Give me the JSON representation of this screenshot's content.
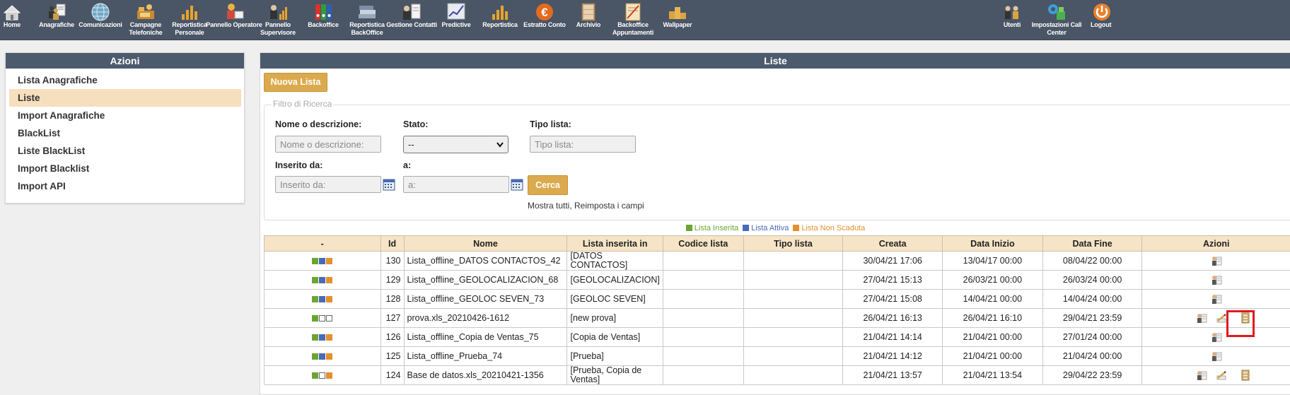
{
  "nav": {
    "items": [
      {
        "label": "Home",
        "icon": "home-icon"
      },
      {
        "label": "Anagrafiche",
        "icon": "people-document-icon"
      },
      {
        "label": "Comunicazioni",
        "icon": "globe-icon"
      },
      {
        "label": "Campagne Telefoniche",
        "icon": "campaign-icon"
      },
      {
        "label": "Reportistica Personale",
        "icon": "bar-chart-icon"
      },
      {
        "label": "Pannello Operatore",
        "icon": "operator-icon"
      },
      {
        "label": "Pannello Supervisore",
        "icon": "supervisor-icon"
      },
      {
        "label": "Backoffice",
        "icon": "binders-icon"
      },
      {
        "label": "Reportistica BackOffice",
        "icon": "books-icon"
      },
      {
        "label": "Gestione Contatti",
        "icon": "contacts-icon"
      },
      {
        "label": "Predictive",
        "icon": "trend-chart-icon"
      },
      {
        "label": "Reportistica",
        "icon": "bar-chart-icon"
      },
      {
        "label": "Estratto Conto",
        "icon": "euro-coin-icon"
      },
      {
        "label": "Archivio",
        "icon": "cabinet-icon"
      },
      {
        "label": "Backoffice Appuntamenti",
        "icon": "appointment-icon"
      },
      {
        "label": "Wallpaper",
        "icon": "podium-icon"
      }
    ],
    "right_items": [
      {
        "label": "Utenti",
        "icon": "users-icon"
      },
      {
        "label": "Impostazioni Call Center",
        "icon": "settings-gears-icon"
      },
      {
        "label": "Logout",
        "icon": "power-icon"
      }
    ]
  },
  "sidebar": {
    "title": "Azioni",
    "items": [
      {
        "label": "Lista Anagrafiche",
        "active": false
      },
      {
        "label": "Liste",
        "active": true
      },
      {
        "label": "Import Anagrafiche",
        "active": false
      },
      {
        "label": "BlackList",
        "active": false
      },
      {
        "label": "Liste BlackList",
        "active": false
      },
      {
        "label": "Import Blacklist",
        "active": false
      },
      {
        "label": "Import API",
        "active": false
      }
    ]
  },
  "main": {
    "title": "Liste",
    "new_button": "Nuova Lista",
    "filter": {
      "legend": "Filtro di Ricerca",
      "name_label": "Nome o descrizione:",
      "name_placeholder": "Nome o descrizione:",
      "state_label": "Stato:",
      "state_value": "--",
      "type_label": "Tipo lista:",
      "type_placeholder": "Tipo lista:",
      "from_label": "Inserito da:",
      "from_placeholder": "Inserito da:",
      "to_label": "a:",
      "to_placeholder": "a:",
      "search_button": "Cerca",
      "reset_text": "Mostra tutti, Reimposta i campi"
    },
    "legend": [
      {
        "label": "Lista Inserita",
        "color": "#6aa532"
      },
      {
        "label": "Lista Attiva",
        "color": "#4a6ab7"
      },
      {
        "label": "Lista Non Scaduta",
        "color": "#e3902d"
      }
    ],
    "table": {
      "headers": [
        "-",
        "Id",
        "Nome",
        "Lista inserita in",
        "Codice lista",
        "Tipo lista",
        "Creata",
        "Data Inizio",
        "Data Fine",
        "Azioni"
      ],
      "rows": [
        {
          "status": [
            "g",
            "b",
            "o"
          ],
          "id": "130",
          "name": "Lista_offline_DATOS CONTACTOS_42",
          "inserted_in": "[DATOS CONTACTOS]",
          "code": "",
          "type": "",
          "created": "30/04/21 17:06",
          "start": "13/04/17 00:00",
          "end": "08/04/22 00:00",
          "actions": "basic"
        },
        {
          "status": [
            "g",
            "b",
            "o"
          ],
          "id": "129",
          "name": "Lista_offline_GEOLOCALIZACION_68",
          "inserted_in": "[GEOLOCALIZACION]",
          "code": "",
          "type": "",
          "created": "27/04/21 15:13",
          "start": "26/03/21 00:00",
          "end": "26/03/24 00:00",
          "actions": "basic"
        },
        {
          "status": [
            "g",
            "b",
            "o"
          ],
          "id": "128",
          "name": "Lista_offline_GEOLOC SEVEN_73",
          "inserted_in": "[GEOLOC SEVEN]",
          "code": "",
          "type": "",
          "created": "27/04/21 15:08",
          "start": "14/04/21 00:00",
          "end": "14/04/24 00:00",
          "actions": "basic"
        },
        {
          "status": [
            "g",
            "e",
            "e"
          ],
          "id": "127",
          "name": "prova.xls_20210426-1612",
          "inserted_in": "[new prova]",
          "code": "",
          "type": "",
          "created": "26/04/21 16:13",
          "start": "26/04/21 16:10",
          "end": "29/04/21 23:59",
          "actions": "full"
        },
        {
          "status": [
            "g",
            "b",
            "o"
          ],
          "id": "126",
          "name": "Lista_offline_Copia de Ventas_75",
          "inserted_in": "[Copia de Ventas]",
          "code": "",
          "type": "",
          "created": "21/04/21 14:14",
          "start": "21/04/21 00:00",
          "end": "27/01/24 00:00",
          "actions": "basic"
        },
        {
          "status": [
            "g",
            "b",
            "o"
          ],
          "id": "125",
          "name": "Lista_offline_Prueba_74",
          "inserted_in": "[Prueba]",
          "code": "",
          "type": "",
          "created": "21/04/21 14:12",
          "start": "21/04/21 00:00",
          "end": "21/04/24 00:00",
          "actions": "basic"
        },
        {
          "status": [
            "g",
            "e",
            "o"
          ],
          "id": "124",
          "name": "Base de datos.xls_20210421-1356",
          "inserted_in": "[Prueba, Copia de Ventas]",
          "code": "",
          "type": "",
          "created": "21/04/21 13:57",
          "start": "21/04/21 13:54",
          "end": "29/04/22 23:59",
          "actions": "full"
        }
      ]
    }
  },
  "colors": {
    "topbar": "#4a5566",
    "panel_header": "#4c5a6d",
    "accent": "#dcaa4e",
    "table_header": "#f6e4c6",
    "highlight": "#e0191f"
  }
}
